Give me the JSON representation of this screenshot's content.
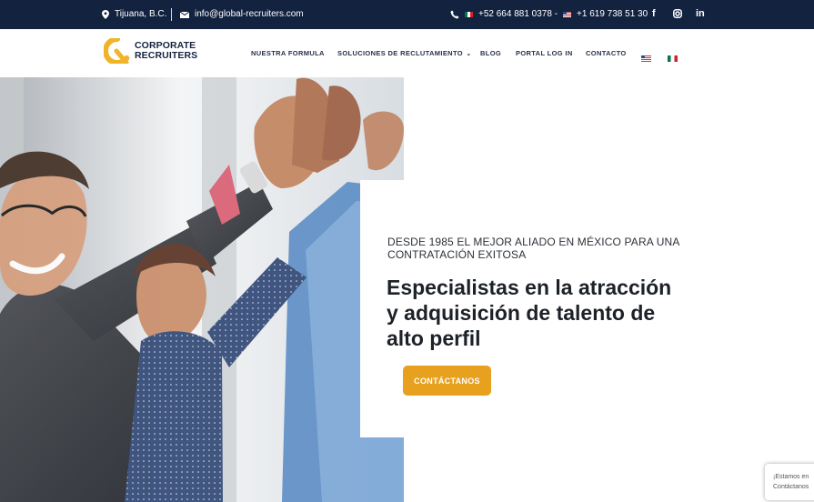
{
  "topbar": {
    "location": "Tijuana, B.C.",
    "email": "info@global-recruiters.com",
    "phone_mx": "+52 664 881 0378 -",
    "phone_us": "+1 619 738 51 30",
    "social": [
      "f",
      "instagram-icon",
      "in"
    ]
  },
  "brand": {
    "line1": "CORPORATE",
    "line2": "RECRUITERS",
    "logo_color": "#f0b429"
  },
  "nav": {
    "items": [
      "NUESTRA FORMULA",
      "SOLUCIONES DE RECLUTAMIENTO",
      "BLOG",
      "PORTAL LOG IN",
      "CONTACTO"
    ],
    "languages": [
      "en-flag-icon",
      "mx-flag-icon"
    ]
  },
  "hero": {
    "kicker": "DESDE 1985 EL MEJOR ALIADO EN MÉXICO PARA UNA CONTRATACIÓN EXITOSA",
    "headline": "Especialistas en la atracción y adquisición de talento de alto perfil",
    "cta_label": "CONTÁCTANOS",
    "image_desc": "team-high-five-photo"
  },
  "chat": {
    "line1": "¡Estamos en",
    "line2": "Contáctanos"
  },
  "colors": {
    "topbar": "#12223f",
    "accent": "#e8a11e",
    "text": "#1d2128"
  }
}
